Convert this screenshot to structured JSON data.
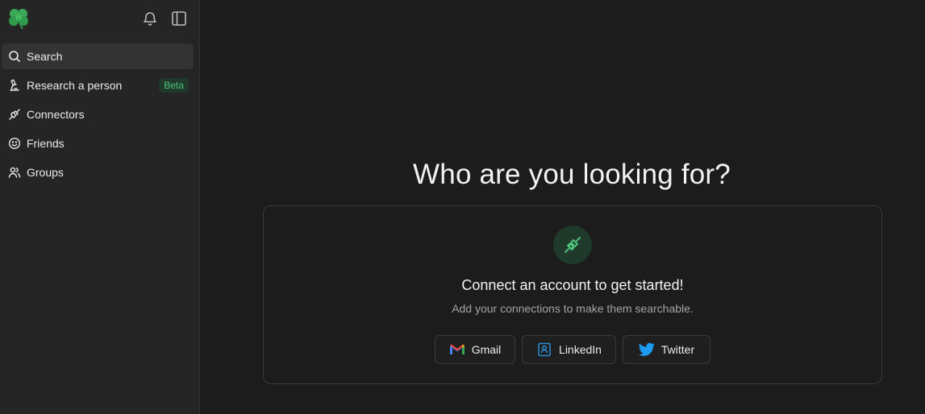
{
  "sidebar": {
    "logo_icon": "clover-logo-icon",
    "items": [
      {
        "label": "Search",
        "icon": "search-icon",
        "active": true
      },
      {
        "label": "Research a person",
        "icon": "microscope-icon",
        "badge": "Beta"
      },
      {
        "label": "Connectors",
        "icon": "plug-icon"
      },
      {
        "label": "Friends",
        "icon": "smiley-icon"
      },
      {
        "label": "Groups",
        "icon": "users-icon"
      }
    ]
  },
  "main": {
    "headline": "Who are you looking for?",
    "card": {
      "title": "Connect an account to get started!",
      "subtitle": "Add your connections to make them searchable.",
      "buttons": [
        {
          "label": "Gmail",
          "icon": "gmail-icon"
        },
        {
          "label": "LinkedIn",
          "icon": "linkedin-icon"
        },
        {
          "label": "Twitter",
          "icon": "twitter-icon"
        }
      ]
    }
  },
  "colors": {
    "accent_green": "#4ec17a",
    "background": "#1c1c1c",
    "sidebar_bg": "#252525"
  }
}
